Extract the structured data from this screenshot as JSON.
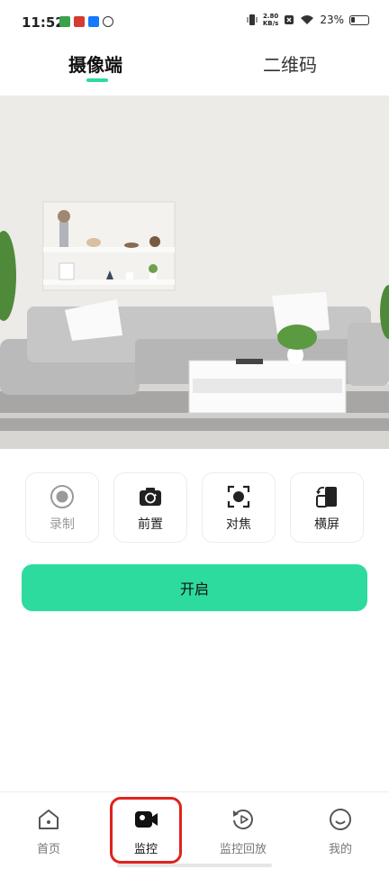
{
  "status_bar": {
    "time": "11:52",
    "net_speed_value": "2.80",
    "net_speed_unit": "KB/s",
    "battery": "23%"
  },
  "tabs": [
    {
      "label": "摄像端",
      "active": true
    },
    {
      "label": "二维码",
      "active": false
    }
  ],
  "controls": [
    {
      "label": "录制",
      "icon": "record-icon",
      "enabled": false
    },
    {
      "label": "前置",
      "icon": "camera-switch-icon",
      "enabled": true
    },
    {
      "label": "对焦",
      "icon": "focus-icon",
      "enabled": true
    },
    {
      "label": "横屏",
      "icon": "rotate-landscape-icon",
      "enabled": true
    }
  ],
  "start_button": {
    "label": "开启"
  },
  "bottom_nav": [
    {
      "label": "首页",
      "icon": "home-icon",
      "active": false
    },
    {
      "label": "监控",
      "icon": "video-camera-icon",
      "active": true
    },
    {
      "label": "监控回放",
      "icon": "replay-icon",
      "active": false
    },
    {
      "label": "我的",
      "icon": "smile-icon",
      "active": false
    }
  ],
  "colors": {
    "accent": "#2edb9f",
    "highlight": "#e0221c"
  }
}
